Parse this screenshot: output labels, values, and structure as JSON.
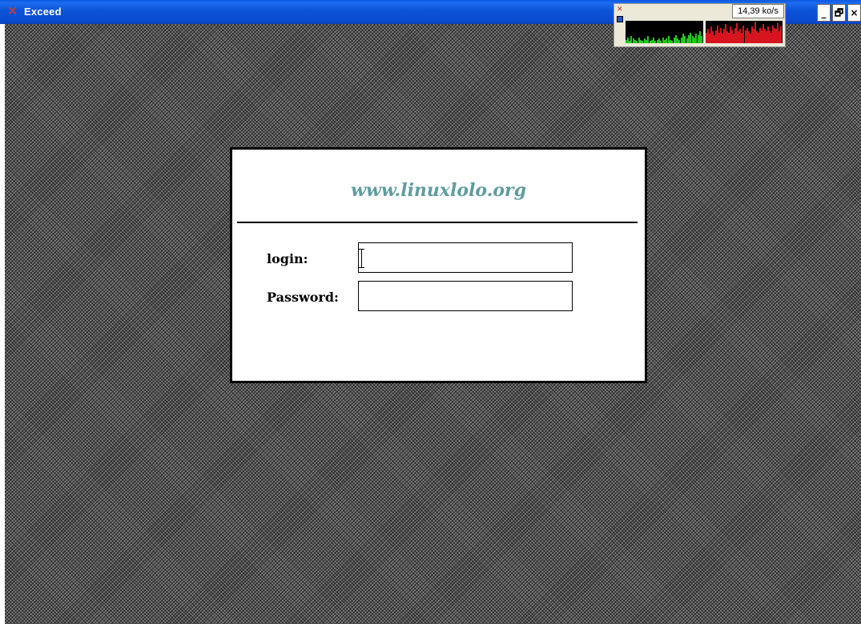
{
  "window": {
    "title": "Exceed",
    "icon": "x-logo-icon",
    "buttons": {
      "minimize": "_",
      "restore": "🗗",
      "close": "×"
    }
  },
  "netmon": {
    "speed": "14,39 ko/s",
    "in_bars": [
      3,
      5,
      2,
      6,
      4,
      3,
      2,
      5,
      3,
      2,
      4,
      3,
      6,
      2,
      3,
      5,
      2,
      3,
      4,
      2,
      5,
      3,
      4,
      6,
      3,
      2,
      5,
      7,
      4,
      3,
      5,
      8,
      6,
      4,
      7,
      9,
      6,
      5,
      8,
      7,
      10,
      6
    ],
    "out_bars": [
      9,
      12,
      8,
      14,
      10,
      7,
      11,
      15,
      9,
      13,
      8,
      12,
      16,
      10,
      9,
      14,
      11,
      8,
      13,
      17,
      10,
      12,
      9,
      15,
      11,
      13,
      10,
      8,
      14,
      12,
      18,
      10,
      9,
      13,
      11,
      16,
      12,
      10,
      14,
      11,
      9,
      15,
      13,
      12,
      17,
      10,
      14
    ]
  },
  "dialog": {
    "site": "www.linuxlolo.org",
    "login_label": "login:",
    "password_label": "Password:",
    "login_value": "",
    "password_value": ""
  },
  "colors": {
    "titlebar": "#0a4cd0",
    "site_text": "#5f9ca0",
    "in_graph": "#1ec81e",
    "out_graph": "#d8141e"
  }
}
